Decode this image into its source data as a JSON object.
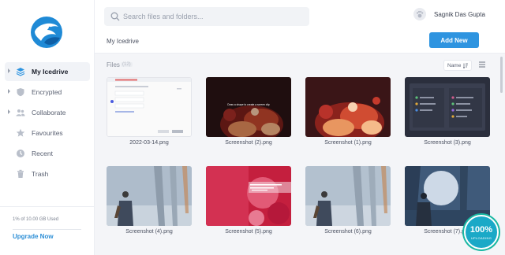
{
  "sidebar": {
    "items": [
      {
        "label": "My Icedrive",
        "icon": "layers-icon",
        "active": true,
        "expandable": true
      },
      {
        "label": "Encrypted",
        "icon": "shield-icon",
        "active": false,
        "expandable": true
      },
      {
        "label": "Collaborate",
        "icon": "users-icon",
        "active": false,
        "expandable": true
      },
      {
        "label": "Favourites",
        "icon": "star-icon",
        "active": false,
        "expandable": false
      },
      {
        "label": "Recent",
        "icon": "clock-icon",
        "active": false,
        "expandable": false
      },
      {
        "label": "Trash",
        "icon": "trash-icon",
        "active": false,
        "expandable": false
      }
    ],
    "usage_text": "1% of 10.00 GB Used",
    "usage_fraction": 0.01,
    "upgrade_label": "Upgrade Now"
  },
  "header": {
    "search_placeholder": "Search files and folders...",
    "user_name": "Sagnik Das Gupta",
    "breadcrumb": "My Icedrive",
    "add_new_label": "Add New"
  },
  "content": {
    "files_label": "Files",
    "files_count": "(12)",
    "sort_label": "Name",
    "files": [
      {
        "name": "2022-03-14.png"
      },
      {
        "name": "Screenshot (2).png"
      },
      {
        "name": "Screenshot (1).png"
      },
      {
        "name": "Screenshot (3).png"
      },
      {
        "name": "Screenshot (4).png"
      },
      {
        "name": "Screenshot (5).png"
      },
      {
        "name": "Screenshot (6).png"
      },
      {
        "name": "Screenshot (7).png"
      }
    ]
  },
  "thumb_texts": {
    "screenshot2_overlay": "Draw a shape to create a screen clip"
  },
  "upload_badge": {
    "percent": "100%",
    "label": "UPLOADING"
  },
  "colors": {
    "accent": "#2e94e0",
    "badge": "#1aa9c7"
  }
}
